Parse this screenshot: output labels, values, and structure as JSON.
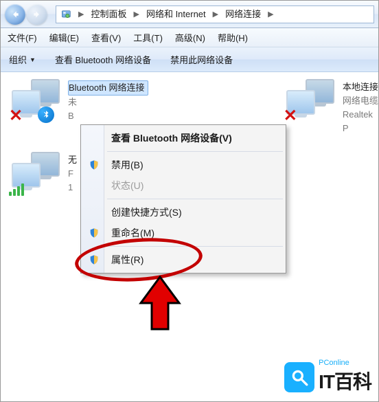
{
  "nav": {
    "breadcrumb": [
      "控制面板",
      "网络和 Internet",
      "网络连接"
    ]
  },
  "menu": {
    "file": "文件(F)",
    "edit": "编辑(E)",
    "view": "查看(V)",
    "tools": "工具(T)",
    "advanced": "高级(N)",
    "help": "帮助(H)"
  },
  "toolbar": {
    "organize": "组织",
    "view_bt": "查看 Bluetooth 网络设备",
    "disable": "禁用此网络设备"
  },
  "connections": {
    "bt": {
      "name": "Bluetooth 网络连接",
      "status": "未",
      "prefix": "B"
    },
    "wifi": {
      "status": "无",
      "line2": "F",
      "line3": "1"
    },
    "lan": {
      "name": "本地连接",
      "status": "网络电缆",
      "line3": "Realtek P"
    }
  },
  "context_menu": {
    "header": "查看 Bluetooth 网络设备(V)",
    "disable": "禁用(B)",
    "status": "状态(U)",
    "shortcut": "创建快捷方式(S)",
    "rename": "重命名(M)",
    "properties": "属性(R)"
  },
  "watermark": {
    "sub": "PConline",
    "main": "IT百科"
  }
}
